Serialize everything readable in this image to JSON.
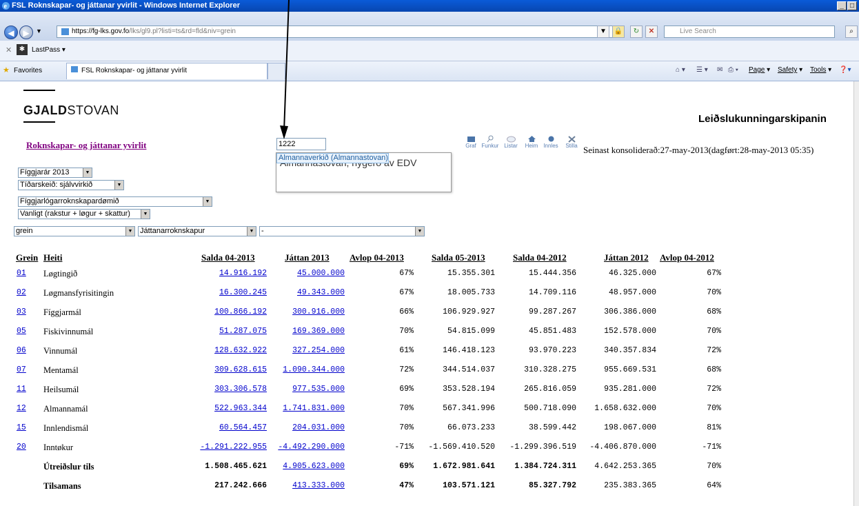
{
  "window": {
    "title": "FSL Roknskapar- og játtanar yvirlit - Windows Internet Explorer",
    "buttons": [
      "_",
      "□"
    ]
  },
  "browser": {
    "url_host": "https://fg-lks.gov.fo",
    "url_path": "/lks/gl9.pl?listi=ts&rd=fld&niv=grein",
    "search_placeholder": "Live Search",
    "lastpass_label": "LastPass ▾",
    "favorites_label": "Favorites",
    "tab_title": "FSL Roknskapar- og játtanar yvirlit",
    "commands": {
      "page": "Page",
      "safety": "Safety",
      "tools": "Tools"
    }
  },
  "page": {
    "logo_bold": "GJALD",
    "logo_rest": "STOVAN",
    "header_right": "Leiðslukunningarskipanin",
    "title_link": "Roknskapar- og játtanar yvirlit",
    "search_value": "1222",
    "suggestions": [
      "Almannaverkið (Almannastovan)",
      "Almannastovan, nýgerð av EDV"
    ],
    "toolbar_icons": [
      "Graf",
      "Funkur",
      "Listar",
      "Heim",
      "Innles",
      "Stilla"
    ],
    "status_text": "Seinast konsoliderað:27-may-2013(dagført:28-may-2013 05:35)",
    "selects": {
      "year": "Fíggjarár 2013",
      "period": "Tíðarskeið: sjálvvirkið",
      "budget_type": "Fíggjarlógarroknskapardømið",
      "mode": "Vanligt (rakstur + løgur + skattur)",
      "level": "grein",
      "account": "Játtanarroknskapur",
      "filter": "-"
    }
  },
  "table": {
    "headers": {
      "grein": "Grein",
      "heiti": "Heiti",
      "salda_04_2013": "Salda 04-2013",
      "jattan_2013": "Játtan 2013",
      "avlop_04_2013": "Avlop 04-2013",
      "salda_05_2013": "Salda 05-2013",
      "salda_04_2012": "Salda 04-2012",
      "jattan_2012": "Játtan 2012",
      "avlop_04_2012": "Avlop 04-2012"
    },
    "rows": [
      {
        "grein": "01",
        "heiti": "Løgtingið",
        "s13": "14.916.192",
        "j13": "45.000.000",
        "a13": "67%",
        "s0513": "15.355.301",
        "s12": "15.444.356",
        "j12": "46.325.000",
        "a12": "67%"
      },
      {
        "grein": "02",
        "heiti": "Løgmansfyrisitingin",
        "s13": "16.300.245",
        "j13": "49.343.000",
        "a13": "67%",
        "s0513": "18.005.733",
        "s12": "14.709.116",
        "j12": "48.957.000",
        "a12": "70%"
      },
      {
        "grein": "03",
        "heiti": "Fíggjarmál",
        "s13": "100.866.192",
        "j13": "300.916.000",
        "a13": "66%",
        "s0513": "106.929.927",
        "s12": "99.287.267",
        "j12": "306.386.000",
        "a12": "68%"
      },
      {
        "grein": "05",
        "heiti": "Fiskivinnumál",
        "s13": "51.287.075",
        "j13": "169.369.000",
        "a13": "70%",
        "s0513": "54.815.099",
        "s12": "45.851.483",
        "j12": "152.578.000",
        "a12": "70%"
      },
      {
        "grein": "06",
        "heiti": "Vinnumál",
        "s13": "128.632.922",
        "j13": "327.254.000",
        "a13": "61%",
        "s0513": "146.418.123",
        "s12": "93.970.223",
        "j12": "340.357.834",
        "a12": "72%"
      },
      {
        "grein": "07",
        "heiti": "Mentamál",
        "s13": "309.628.615",
        "j13": "1.090.344.000",
        "a13": "72%",
        "s0513": "344.514.037",
        "s12": "310.328.275",
        "j12": "955.669.531",
        "a12": "68%"
      },
      {
        "grein": "11",
        "heiti": "Heilsumál",
        "s13": "303.306.578",
        "j13": "977.535.000",
        "a13": "69%",
        "s0513": "353.528.194",
        "s12": "265.816.059",
        "j12": "935.281.000",
        "a12": "72%"
      },
      {
        "grein": "12",
        "heiti": "Almannamál",
        "s13": "522.963.344",
        "j13": "1.741.831.000",
        "a13": "70%",
        "s0513": "567.341.996",
        "s12": "500.718.090",
        "j12": "1.658.632.000",
        "a12": "70%"
      },
      {
        "grein": "15",
        "heiti": "Innlendismál",
        "s13": "60.564.457",
        "j13": "204.031.000",
        "a13": "70%",
        "s0513": "66.073.233",
        "s12": "38.599.442",
        "j12": "198.067.000",
        "a12": "81%"
      },
      {
        "grein": "20",
        "heiti": "Inntøkur",
        "s13": "-1.291.222.955",
        "j13": "-4.492.290.000",
        "a13": "-71%",
        "s0513": "-1.569.410.520",
        "s12": "-1.299.396.519",
        "j12": "-4.406.870.000",
        "a12": "-71%"
      }
    ],
    "totals": [
      {
        "heiti": "Útreiðslur tils",
        "s13": "1.508.465.621",
        "j13": "4.905.623.000",
        "a13": "69%",
        "s0513": "1.672.981.641",
        "s12": "1.384.724.311",
        "j12": "4.642.253.365",
        "a12": "70%"
      },
      {
        "heiti": "Tilsamans",
        "s13": "217.242.666",
        "j13": "413.333.000",
        "a13": "47%",
        "s0513": "103.571.121",
        "s12": "85.327.792",
        "j12": "235.383.365",
        "a12": "64%"
      }
    ]
  }
}
